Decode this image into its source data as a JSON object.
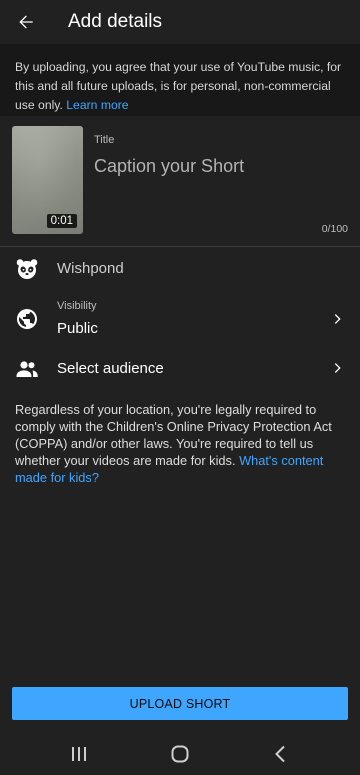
{
  "header": {
    "title": "Add details",
    "back_icon": "arrow-left-icon"
  },
  "notice": {
    "text": "By uploading, you agree that your use of YouTube music, for this and all future uploads, is for personal, non-commercial use only. ",
    "link": "Learn more"
  },
  "video": {
    "duration": "0:01",
    "title_label": "Title",
    "title_placeholder": "Caption your Short",
    "title_value": "",
    "char_count": "0/100"
  },
  "channel": {
    "name": "Wishpond",
    "icon": "panda-avatar-icon"
  },
  "visibility": {
    "label": "Visibility",
    "value": "Public",
    "icon": "globe-icon"
  },
  "audience": {
    "label": "Select audience",
    "icon": "people-icon"
  },
  "legal": {
    "text": "Regardless of your location, you're legally required to comply with the Children's Online Privacy Protection Act (COPPA) and/or other laws. You're required to tell us whether your videos are made for kids. ",
    "link": "What's content made for kids?"
  },
  "actions": {
    "upload_label": "UPLOAD SHORT"
  },
  "colors": {
    "background": "#212121",
    "accent": "#3ea6ff",
    "notice_background": "#181818"
  }
}
